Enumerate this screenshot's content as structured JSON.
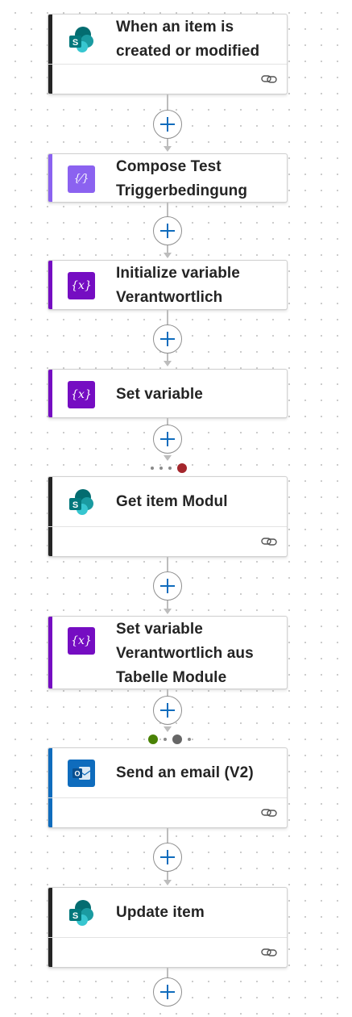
{
  "colors": {
    "sharepoint_bar": "#242424",
    "compose_bar": "#8b62f0",
    "variable_bar": "#750dc2",
    "outlook_bar": "#0f6cbd",
    "compose_icon_bg": "#8b62f0",
    "variable_icon_bg": "#750dc2",
    "outlook_icon_bg": "#0f6cbd",
    "status_failed": "#a4262c",
    "status_success": "#498205",
    "status_skipped": "#666666"
  },
  "steps": [
    {
      "title": "When an item is created or modified",
      "icon": "sharepoint-icon"
    },
    {
      "title": "Compose Test Triggerbedingung",
      "icon": "compose-icon"
    },
    {
      "title": "Initialize variable Verantwortlich",
      "icon": "variable-icon"
    },
    {
      "title": "Set variable",
      "icon": "variable-icon"
    },
    {
      "title": "Get item Modul",
      "icon": "sharepoint-icon"
    },
    {
      "title": "Set variable Verantwortlich aus Tabelle Module",
      "icon": "variable-icon"
    },
    {
      "title": "Send an email (V2)",
      "icon": "outlook-icon"
    },
    {
      "title": "Update item",
      "icon": "sharepoint-icon"
    }
  ],
  "icons": {
    "variable_text": "{x}",
    "compose_text": "{⁄}",
    "outlook_letter": "O"
  }
}
